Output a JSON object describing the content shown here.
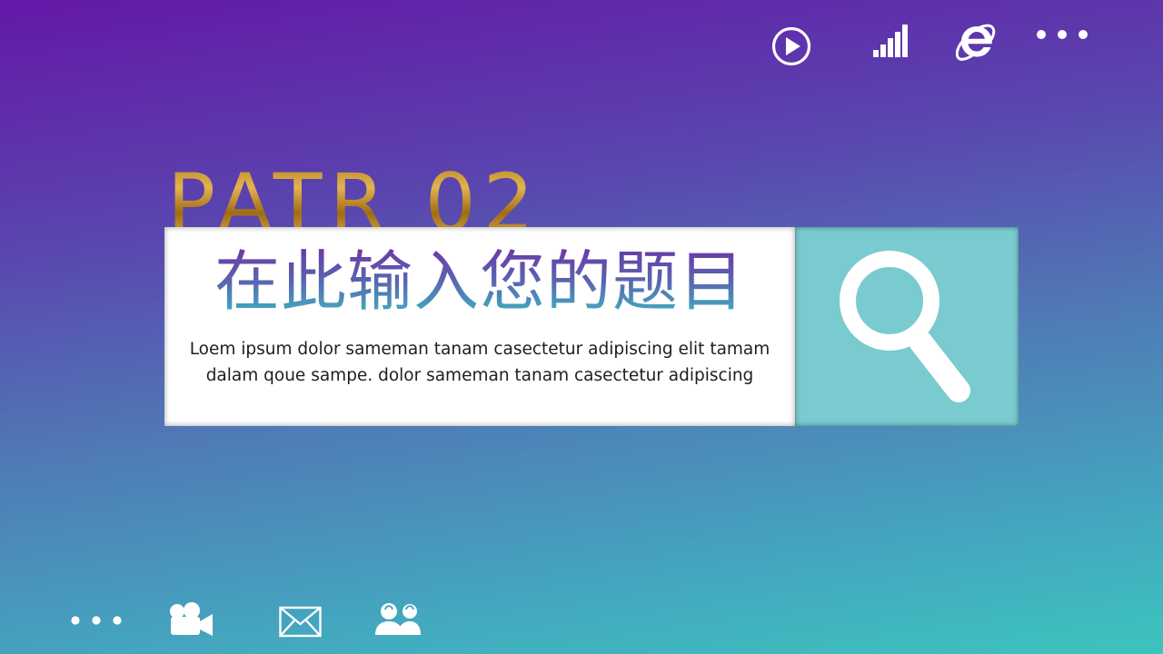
{
  "slide": {
    "section_number": "PATR 02",
    "title": "在此输入您的题目",
    "body": "Loem ipsum dolor sameman tanam casectetur adipiscing elit tamam dalam qoue sampe. dolor sameman tanam casectetur adipiscing"
  },
  "top_icons": [
    "play-icon",
    "signal-bars-icon",
    "internet-explorer-icon",
    "more-dots-icon"
  ],
  "bottom_icons": [
    "more-dots-icon",
    "video-camera-icon",
    "mail-icon",
    "users-icon"
  ],
  "colors": {
    "gradient_top": "#6418a8",
    "gradient_bottom": "#3cc4be",
    "search_panel": "#7acbd0",
    "card": "#ffffff",
    "gold": "#c99a3a",
    "body_text": "#1e1e1e"
  }
}
